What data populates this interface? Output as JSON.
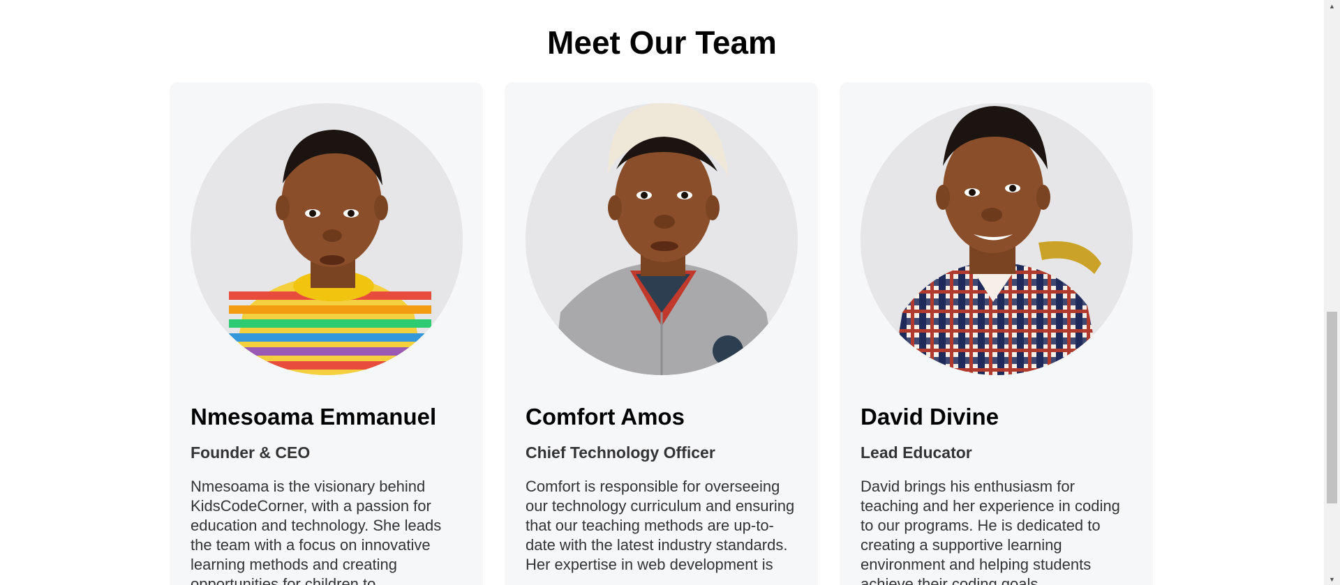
{
  "section": {
    "title": "Meet Our Team"
  },
  "members": [
    {
      "name": "Nmesoama Emmanuel",
      "role": "Founder & CEO",
      "bio": "Nmesoama is the visionary behind KidsCodeCorner, with a passion for education and technology. She leads the team with a focus on innovative learning methods and creating opportunities for children to",
      "photo_icon": "portrait-photo",
      "shirt": "rainbow-striped"
    },
    {
      "name": "Comfort Amos",
      "role": "Chief Technology Officer",
      "bio": "Comfort is responsible for overseeing our technology curriculum and ensuring that our teaching methods are up-to-date with the latest industry standards. Her expertise in web development is",
      "photo_icon": "portrait-photo",
      "shirt": "grey-jacket"
    },
    {
      "name": "David Divine",
      "role": "Lead Educator",
      "bio": "David brings his enthusiasm for teaching and her experience in coding to our programs. He is dedicated to creating a supportive learning environment and helping students achieve their coding goals.",
      "photo_icon": "portrait-photo",
      "shirt": "plaid"
    }
  ],
  "colors": {
    "card_bg": "#f6f7f9",
    "photo_bg": "#e6e6e8",
    "skin": "#8a4f2a",
    "text_primary": "#000000",
    "text_secondary": "#333333"
  },
  "scrollbar": {
    "up_icon": "triangle-up-icon",
    "down_icon": "triangle-down-icon"
  }
}
